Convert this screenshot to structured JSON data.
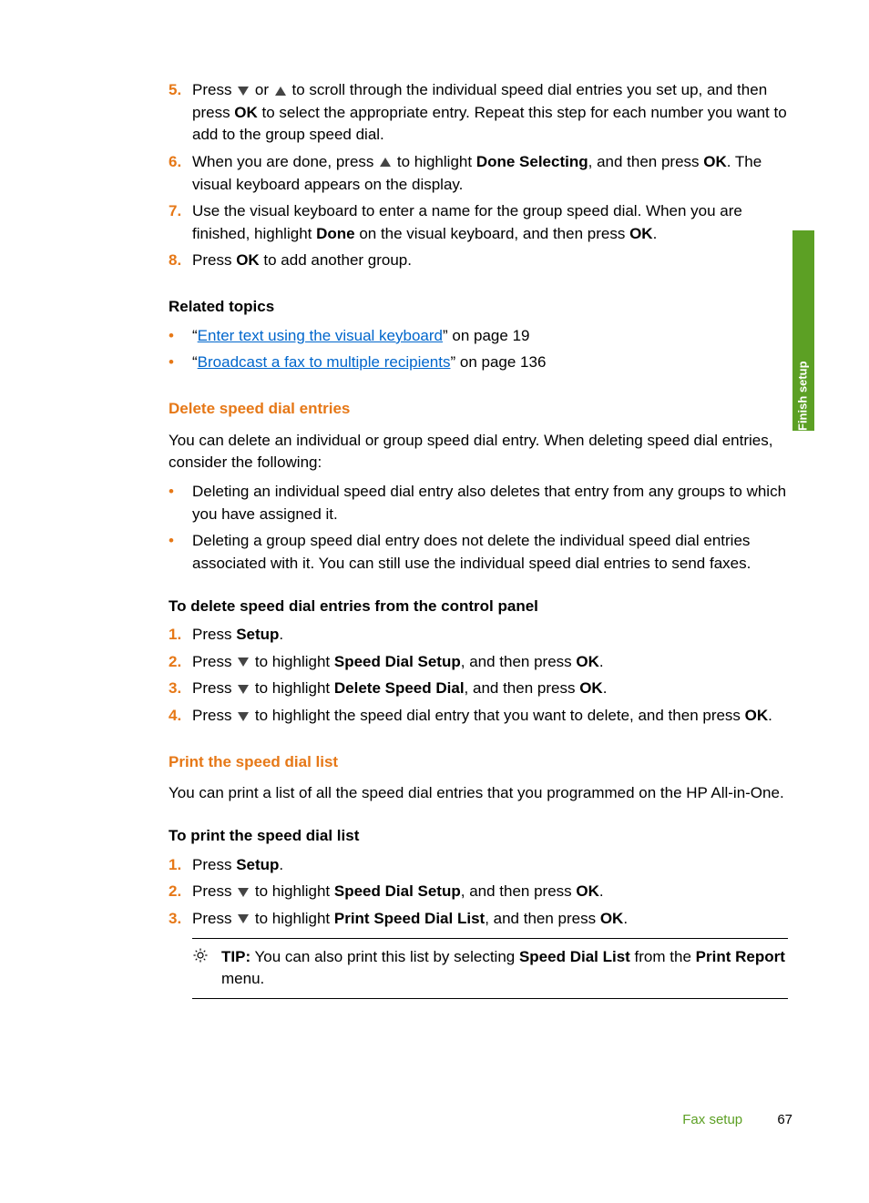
{
  "sideTab": "Finish setup",
  "steps_continued": {
    "5": {
      "pre": "Press ",
      "mid1": " or ",
      "mid2": " to scroll through the individual speed dial entries you set up, and then press ",
      "ok": "OK",
      "post": " to select the appropriate entry. Repeat this step for each number you want to add to the group speed dial."
    },
    "6": {
      "pre": "When you are done, press ",
      "mid": " to highlight ",
      "done_sel": "Done Selecting",
      "mid2": ", and then press ",
      "ok": "OK",
      "post": ". The visual keyboard appears on the display."
    },
    "7": {
      "pre": "Use the visual keyboard to enter a name for the group speed dial. When you are finished, highlight ",
      "done": "Done",
      "mid": " on the visual keyboard, and then press ",
      "ok": "OK",
      "post": "."
    },
    "8": {
      "pre": "Press ",
      "ok": "OK",
      "post": " to add another group."
    }
  },
  "related": {
    "heading": "Related topics",
    "items": [
      {
        "q1": "“",
        "link": "Enter text using the visual keyboard",
        "q2": "”",
        "suffix": " on page 19"
      },
      {
        "q1": "“",
        "link": "Broadcast a fax to multiple recipients",
        "q2": "”",
        "suffix": " on page 136"
      }
    ]
  },
  "delete": {
    "heading": "Delete speed dial entries",
    "intro": "You can delete an individual or group speed dial entry. When deleting speed dial entries, consider the following:",
    "bullets": [
      "Deleting an individual speed dial entry also deletes that entry from any groups to which you have assigned it.",
      "Deleting a group speed dial entry does not delete the individual speed dial entries associated with it. You can still use the individual speed dial entries to send faxes."
    ],
    "procHead": "To delete speed dial entries from the control panel",
    "steps": {
      "1": {
        "pre": "Press ",
        "b": "Setup",
        "post": "."
      },
      "2": {
        "pre": "Press ",
        "mid": " to highlight ",
        "b": "Speed Dial Setup",
        "post": ", and then press ",
        "ok": "OK",
        "end": "."
      },
      "3": {
        "pre": "Press ",
        "mid": " to highlight ",
        "b": "Delete Speed Dial",
        "post": ", and then press ",
        "ok": "OK",
        "end": "."
      },
      "4": {
        "pre": "Press ",
        "mid": " to highlight the speed dial entry that you want to delete, and then press ",
        "ok": "OK",
        "end": "."
      }
    }
  },
  "print": {
    "heading": "Print the speed dial list",
    "intro": "You can print a list of all the speed dial entries that you programmed on the HP All-in-One.",
    "procHead": "To print the speed dial list",
    "steps": {
      "1": {
        "pre": "Press ",
        "b": "Setup",
        "post": "."
      },
      "2": {
        "pre": "Press ",
        "mid": " to highlight ",
        "b": "Speed Dial Setup",
        "post": ", and then press ",
        "ok": "OK",
        "end": "."
      },
      "3": {
        "pre": "Press ",
        "mid": " to highlight ",
        "b": "Print Speed Dial List",
        "post": ", and then press ",
        "ok": "OK",
        "end": "."
      }
    },
    "tip": {
      "label": "TIP:",
      "pre": "  You can also print this list by selecting ",
      "b1": "Speed Dial List",
      "mid": " from the ",
      "b2": "Print Report",
      "post": " menu."
    }
  },
  "footer": {
    "section": "Fax setup",
    "page": "67"
  }
}
